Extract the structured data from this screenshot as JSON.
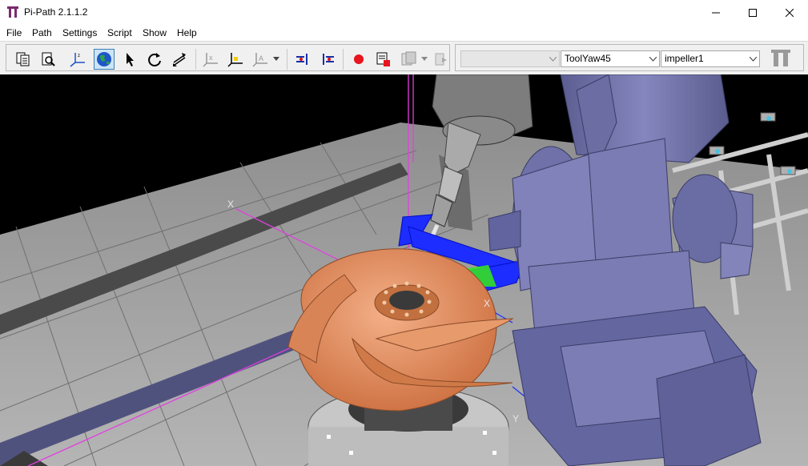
{
  "window": {
    "title": "Pi-Path 2.1.1.2",
    "logo_icon": "pi-path-logo-icon",
    "controls": [
      "minimize-icon",
      "maximize-icon",
      "close-icon"
    ]
  },
  "menu": {
    "items": [
      "File",
      "Path",
      "Settings",
      "Script",
      "Show",
      "Help"
    ]
  },
  "toolbar": {
    "buttons": [
      {
        "icon": "copy-document-icon"
      },
      {
        "icon": "print-preview-icon"
      },
      {
        "icon": "axes-frame-icon"
      },
      {
        "icon": "globe-icon",
        "active": true
      },
      {
        "icon": "arrow-cursor-icon"
      },
      {
        "icon": "rotate-icon"
      },
      {
        "icon": "swap-arrows-icon"
      },
      {
        "icon": "frame-x-icon"
      },
      {
        "icon": "frame-yellow-icon"
      },
      {
        "icon": "frame-a-icon"
      },
      {
        "icon": "dropdown-caret-icon"
      },
      {
        "icon": "insert-point-icon"
      },
      {
        "icon": "split-path-icon"
      },
      {
        "icon": "record-icon"
      },
      {
        "icon": "stop-record-icon"
      },
      {
        "icon": "script-disabled-icon"
      },
      {
        "icon": "dropdown-caret-icon"
      },
      {
        "icon": "export-disabled-icon"
      }
    ],
    "combo_empty": "",
    "tool_combo": "ToolYaw45",
    "part_combo": "impeller1",
    "brand_icon": "pi-path-watermark-icon"
  },
  "viewport": {
    "axis_labels": [
      "X",
      "X",
      "Y"
    ],
    "colors": {
      "sky": "#000000",
      "floor": "#a9a9a9",
      "robot": "#7274a8",
      "impeller": "#e8946a",
      "axis_magenta": "#e040e0",
      "path_blue": "#1d2cff",
      "path_green": "#34e024"
    }
  }
}
